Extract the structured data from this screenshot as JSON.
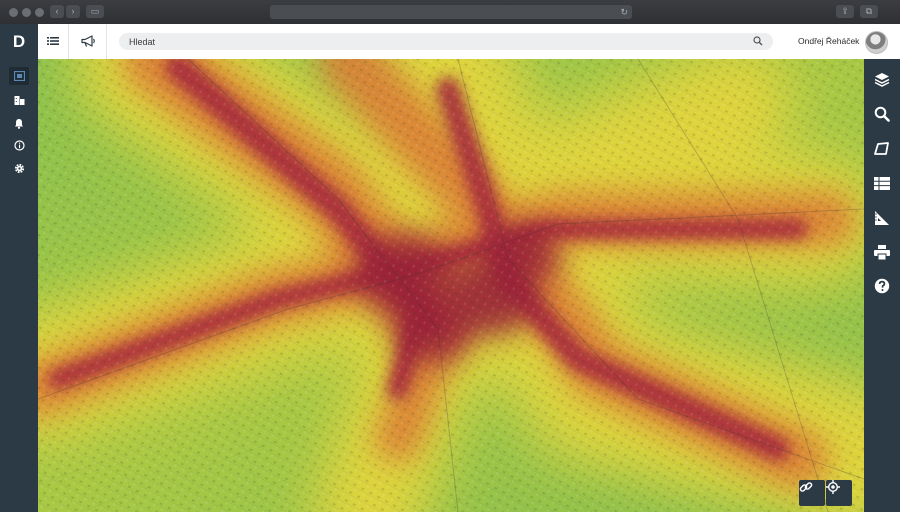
{
  "app": {
    "logo_letter": "D"
  },
  "left_nav": {
    "items": [
      {
        "name": "map-view",
        "icon": "map-icon",
        "active": true
      },
      {
        "name": "buildings",
        "icon": "buildings-icon",
        "active": false
      },
      {
        "name": "notifications",
        "icon": "bell-icon",
        "active": false
      },
      {
        "name": "info",
        "icon": "info-icon",
        "active": false
      },
      {
        "name": "settings",
        "icon": "gear-icon",
        "active": false
      }
    ]
  },
  "topbar": {
    "search_placeholder": "Hledat",
    "user_name": "Ondřej Řeháček"
  },
  "right_toolbar": {
    "items": [
      {
        "name": "layers",
        "icon": "layers-icon"
      },
      {
        "name": "search",
        "icon": "search-icon"
      },
      {
        "name": "draw",
        "icon": "polygon-icon"
      },
      {
        "name": "table",
        "icon": "table-icon"
      },
      {
        "name": "measure",
        "icon": "ruler-icon"
      },
      {
        "name": "print",
        "icon": "printer-icon"
      },
      {
        "name": "help",
        "icon": "help-icon"
      }
    ]
  },
  "map": {
    "overlay": "heatmap",
    "heat_colors": {
      "low": "#8ec54a",
      "mid": "#e3d63a",
      "high": "#a8283f"
    },
    "bottom_buttons": [
      {
        "name": "share-link",
        "icon": "link-icon"
      },
      {
        "name": "locate",
        "icon": "crosshair-icon"
      }
    ]
  }
}
